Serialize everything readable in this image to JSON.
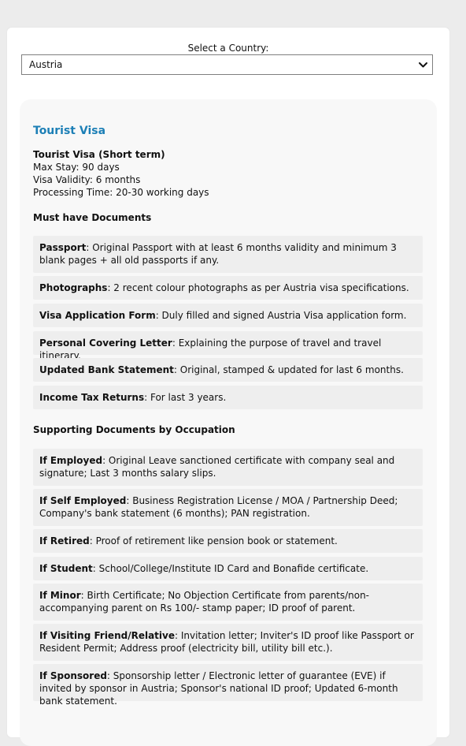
{
  "country_select": {
    "label": "Select a Country:",
    "value": "Austria"
  },
  "visa": {
    "title": "Tourist Visa",
    "subtitle": "Tourist Visa (Short term)",
    "max_stay": "Max Stay: 90 days",
    "validity": "Visa Validity: 6 months",
    "processing": "Processing Time: 20-30 working days"
  },
  "must_have": {
    "heading": "Must have Documents",
    "items": [
      {
        "label": "Passport",
        "text": ": Original Passport with at least 6 months validity and minimum 3 blank pages + all old passports if any."
      },
      {
        "label": "Photographs",
        "text": ": 2 recent colour photographs as per Austria visa specifications."
      },
      {
        "label": "Visa Application Form",
        "text": ": Duly filled and signed Austria Visa application form."
      },
      {
        "label": "Personal Covering Letter",
        "text": ": Explaining the purpose of travel and travel itinerary."
      },
      {
        "label": "Updated Bank Statement",
        "text": ": Original, stamped & updated for last 6 months."
      },
      {
        "label": "Income Tax Returns",
        "text": ": For last 3 years."
      }
    ]
  },
  "occupation": {
    "heading": "Supporting Documents by Occupation",
    "items": [
      {
        "label": "If Employed",
        "text": ": Original Leave sanctioned certificate with company seal and signature; Last 3 months salary slips."
      },
      {
        "label": "If Self Employed",
        "text": ": Business Registration License / MOA / Partnership Deed; Company's bank statement (6 months); PAN registration."
      },
      {
        "label": "If Retired",
        "text": ": Proof of retirement like pension book or statement."
      },
      {
        "label": "If Student",
        "text": ": School/College/Institute ID Card and Bonafide certificate."
      },
      {
        "label": "If Minor",
        "text": ": Birth Certificate; No Objection Certificate from parents/non-accompanying parent on Rs 100/- stamp paper; ID proof of parent."
      },
      {
        "label": "If Visiting Friend/Relative",
        "text": ": Invitation letter; Inviter's ID proof like Passport or Resident Permit; Address proof (electricity bill, utility bill etc.)."
      },
      {
        "label": "If Sponsored",
        "text": ": Sponsorship letter / Electronic letter of guarantee (EVE) if invited by sponsor in Austria; Sponsor's national ID proof; Updated 6-month bank statement."
      }
    ]
  },
  "colors": {
    "accent": "#1c7fb6",
    "item_bg": "#eeeeee",
    "panel_bg": "#f8f8f8",
    "page_bg": "#ececec"
  },
  "icons": {
    "select_arrow": "chevron-down-icon"
  }
}
